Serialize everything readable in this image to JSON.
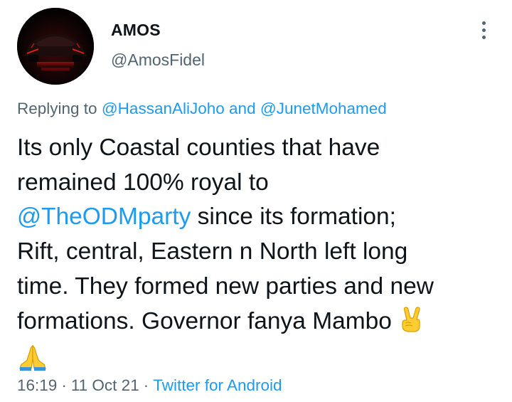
{
  "tweet": {
    "author": {
      "display_name": "AMOS",
      "handle": "@AmosFidel",
      "avatar_icon": "red-sports-car-avatar"
    },
    "more_icon": "more-vertical-icon",
    "replying": {
      "prefix": "Replying to",
      "mention_1": "@HassanAliJoho",
      "joiner": "and",
      "mention_2": "@JunetMohamed"
    },
    "body": {
      "line_1": "Its only Coastal counties that have",
      "line_2": "remained 100% royal to",
      "mention": "@TheODMparty",
      "line_3_rest": " since its formation;",
      "line_4": "Rift, central, Eastern n North left long",
      "line_5": "time. They formed new parties and new",
      "line_6": "formations. Governor fanya Mambo",
      "emoji_1": "victory-hand-emoji",
      "emoji_2": "folded-hands-emoji"
    },
    "meta": {
      "time": "16:19",
      "date": "11 Oct 21",
      "separator": "·",
      "source": "Twitter for Android"
    },
    "colors": {
      "link": "#1d9bf0",
      "secondary_text": "#536471",
      "primary_text": "#0f1419",
      "background": "#ffffff"
    }
  }
}
